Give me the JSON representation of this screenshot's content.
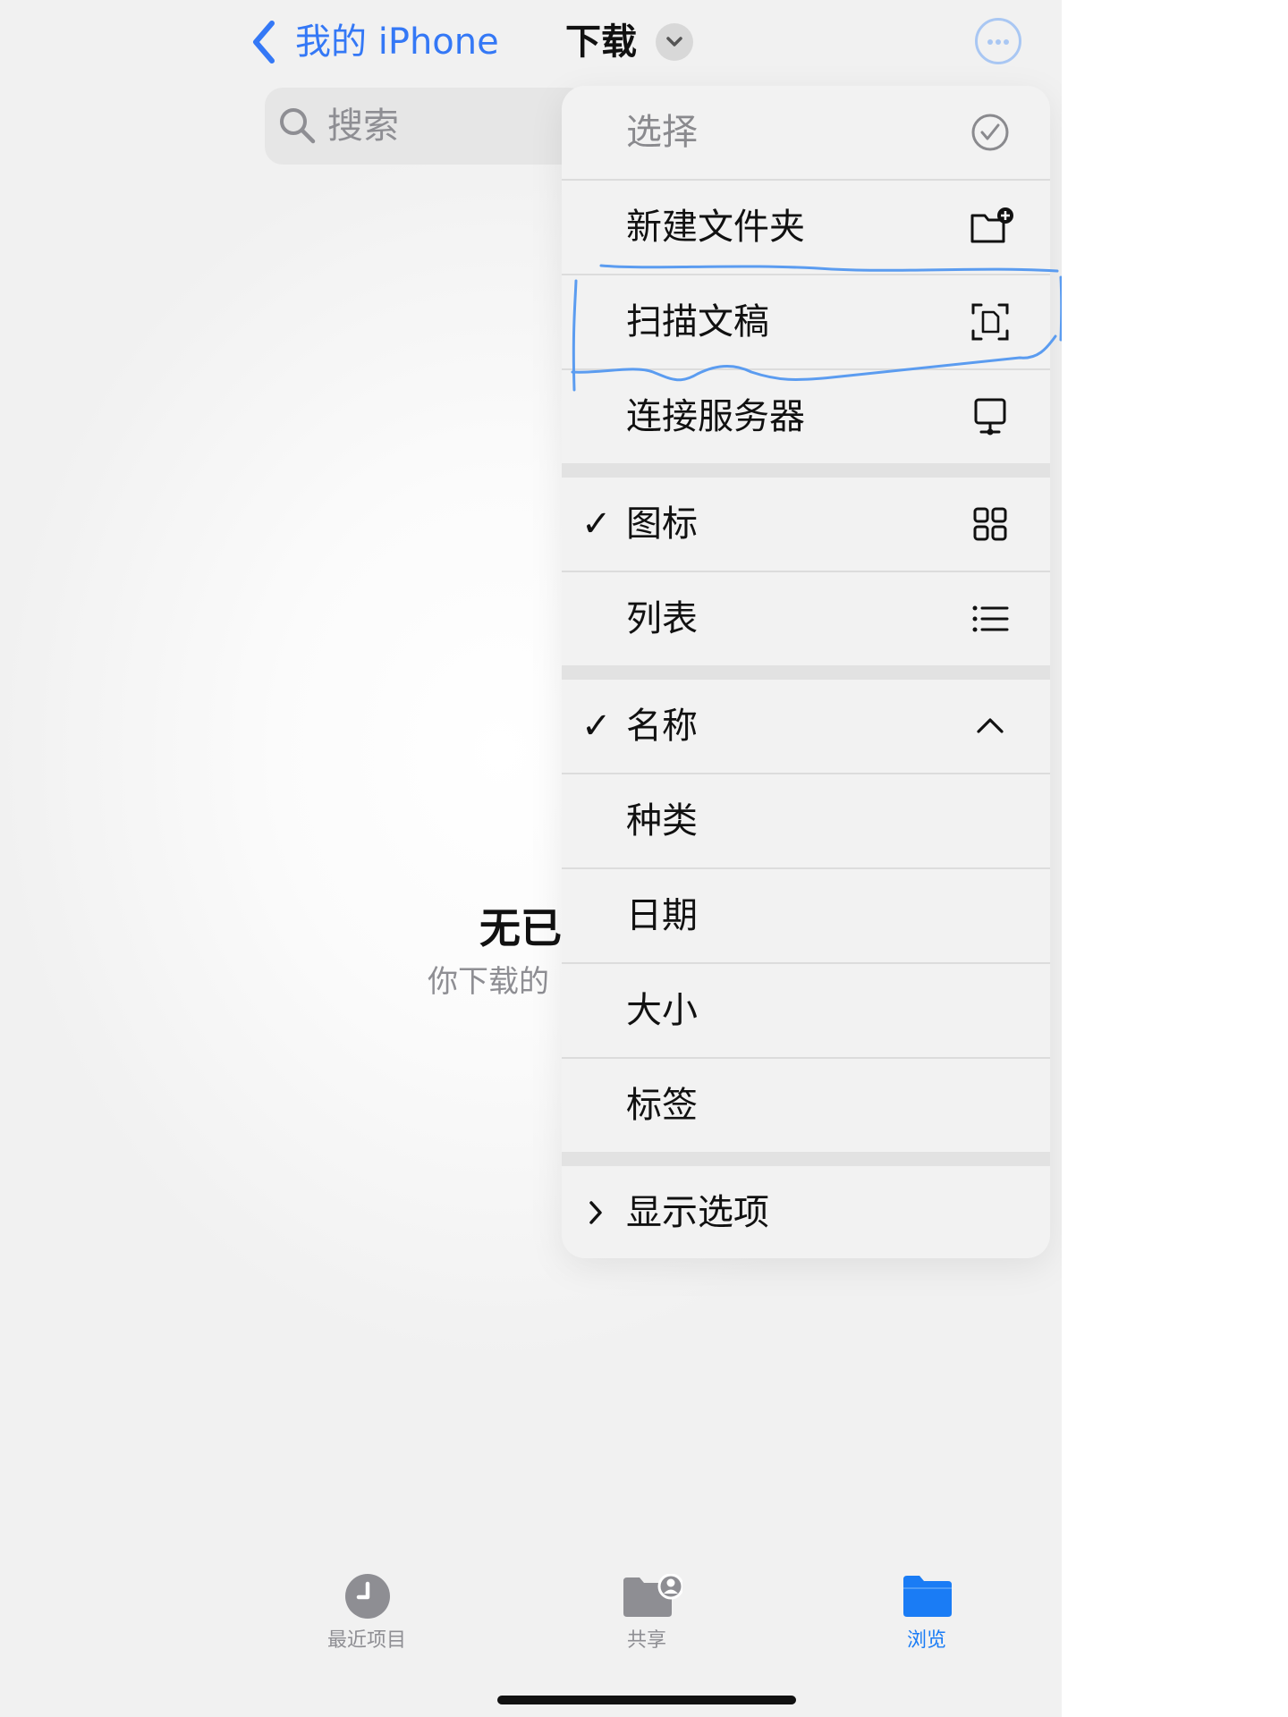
{
  "navbar": {
    "back_label": "我的 iPhone",
    "title": "下载"
  },
  "search": {
    "placeholder": "搜索"
  },
  "empty_state": {
    "title": "无已",
    "subtitle": "你下载的"
  },
  "menu": {
    "select": {
      "label": "选择",
      "icon": "checkmark-circle-icon"
    },
    "new_folder": {
      "label": "新建文件夹",
      "icon": "folder-plus-icon"
    },
    "scan": {
      "label": "扫描文稿",
      "icon": "doc-scan-icon"
    },
    "connect_server": {
      "label": "连接服务器",
      "icon": "server-display-icon"
    },
    "view_icons": {
      "label": "图标",
      "checked": true,
      "icon": "grid-icon"
    },
    "view_list": {
      "label": "列表",
      "checked": false,
      "icon": "list-icon"
    },
    "sort_name": {
      "label": "名称",
      "checked": true,
      "icon": "chevron-up-icon"
    },
    "sort_kind": {
      "label": "种类"
    },
    "sort_date": {
      "label": "日期"
    },
    "sort_size": {
      "label": "大小"
    },
    "sort_tags": {
      "label": "标签"
    },
    "view_options": {
      "label": "显示选项",
      "icon": "chevron-right-icon"
    },
    "check_glyph": "✓"
  },
  "annotation": {
    "color": "#5b9cf0"
  },
  "tabbar": {
    "recents": {
      "label": "最近项目"
    },
    "shared": {
      "label": "共享"
    },
    "browse": {
      "label": "浏览",
      "active": true
    }
  },
  "colors": {
    "accent": "#3478f6",
    "tab_active": "#1a7cf5",
    "tab_inactive": "#8e8e93"
  }
}
